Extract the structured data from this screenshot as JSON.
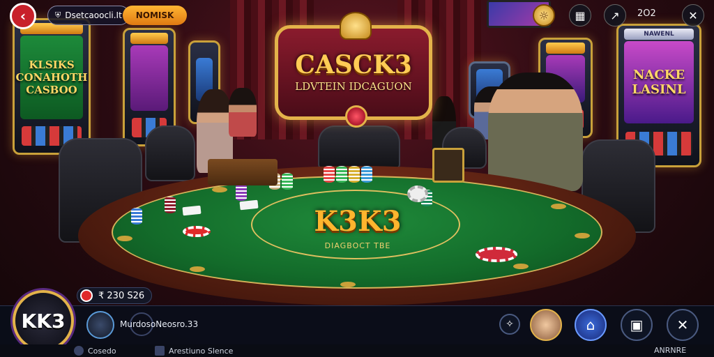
{
  "header": {
    "back_icon": "chevron-left-icon",
    "title_pill": "Dsetcaoocli.It",
    "orange_pill": "NOMISK",
    "right_value": "2O2",
    "icons": [
      "coin-icon",
      "gift-icon",
      "share-icon",
      "close-icon"
    ]
  },
  "banner": {
    "title": "CASCK3",
    "subtitle": "LDVTEIN IDCAGUON"
  },
  "slots": {
    "left_big": "KLSIKS\nCONAHOTH\nCASBOO",
    "right_big": "NACKE\nLASINL",
    "right_top": "NAWENL"
  },
  "table": {
    "logo": "K3K3",
    "subtitle": "DIAGBOCT TBE"
  },
  "footer": {
    "logo_text": "KK3",
    "balance": "₹ 230 S26",
    "player_name": "MurdosoNeosro.33",
    "buttons": [
      "compass-icon",
      "avatar",
      "bank-icon",
      "lock-icon",
      "tools-icon"
    ],
    "strip": {
      "left": "Cosedo",
      "center": "Arestiuno Slence",
      "right": "ANRNRE"
    }
  },
  "colors": {
    "accent_gold": "#e3b34a",
    "felt_green": "#136b2a",
    "back_red": "#c8202a"
  }
}
